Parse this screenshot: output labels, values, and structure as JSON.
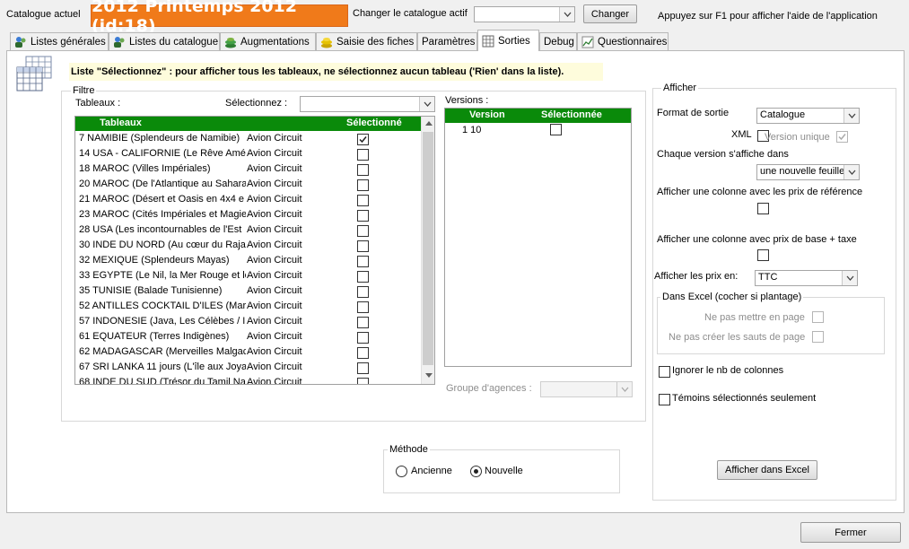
{
  "header": {
    "current_catalog_label": "Catalogue actuel",
    "catalog_name": "2012 Printemps 2012 (id:18)",
    "change_label": "Changer le catalogue actif",
    "change_button": "Changer",
    "help_text": "Appuyez sur F1 pour afficher l'aide de l'application"
  },
  "tabs": [
    {
      "label": "Listes générales",
      "icon": "people-icon"
    },
    {
      "label": "Listes du catalogue",
      "icon": "people-icon"
    },
    {
      "label": "Augmentations",
      "icon": "coins-icon"
    },
    {
      "label": "Saisie des fiches",
      "icon": "coins-icon"
    },
    {
      "label": "Paramètres",
      "icon": ""
    },
    {
      "label": "Sorties",
      "icon": "table-icon"
    },
    {
      "label": "Debug",
      "icon": ""
    },
    {
      "label": "Questionnaires",
      "icon": "chart-icon"
    }
  ],
  "info_text": "Liste \"Sélectionnez\" : pour afficher tous les tableaux, ne sélectionnez aucun tableau ('Rien' dans la liste).",
  "filtre": {
    "legend": "Filtre",
    "tableaux_label": "Tableaux :",
    "select_label": "Sélectionnez :",
    "select_value": "",
    "columns": [
      "Tableaux",
      "Sélectionné"
    ],
    "rows": [
      {
        "name": "7 NAMIBIE (Splendeurs de Namibie)",
        "type": "Avion Circuit",
        "checked": true
      },
      {
        "name": "14 USA - CALIFORNIE (Le Rêve Amé",
        "type": "Avion Circuit",
        "checked": false
      },
      {
        "name": "18 MAROC (Villes Impériales)",
        "type": "Avion Circuit",
        "checked": false
      },
      {
        "name": "20 MAROC (De l'Atlantique au Sahara",
        "type": "Avion Circuit",
        "checked": false
      },
      {
        "name": "21 MAROC (Désert et Oasis en 4x4 e",
        "type": "Avion Circuit",
        "checked": false
      },
      {
        "name": "23 MAROC (Cités Impériales et Magie",
        "type": "Avion Circuit",
        "checked": false
      },
      {
        "name": "28 USA (Les incontournables de l'Est",
        "type": "Avion Circuit",
        "checked": false
      },
      {
        "name": "30 INDE DU NORD (Au cœur du Raja",
        "type": "Avion Circuit",
        "checked": false
      },
      {
        "name": "32 MEXIQUE (Splendeurs Mayas)",
        "type": "Avion Circuit",
        "checked": false
      },
      {
        "name": "33 EGYPTE (Le Nil, la Mer Rouge et le",
        "type": "Avion Circuit",
        "checked": false
      },
      {
        "name": "35 TUNISIE (Balade Tunisienne)",
        "type": "Avion Circuit",
        "checked": false
      },
      {
        "name": "52 ANTILLES COCKTAIL D'ILES (Marie",
        "type": "Avion Circuit",
        "checked": false
      },
      {
        "name": "57 INDONESIE (Java, Les Célèbes / I",
        "type": "Avion Circuit",
        "checked": false
      },
      {
        "name": "61 EQUATEUR (Terres Indigènes)",
        "type": "Avion Circuit",
        "checked": false
      },
      {
        "name": "62 MADAGASCAR (Merveilles Malgac",
        "type": "Avion Circuit",
        "checked": false
      },
      {
        "name": "67 SRI LANKA 11 jours (L'île aux Joya",
        "type": "Avion Circuit",
        "checked": false
      },
      {
        "name": "68 INDE DU SUD (Trésor du Tamil Na",
        "type": "Avion Circuit",
        "checked": false
      }
    ],
    "versions_label": "Versions :",
    "version_columns": [
      "Version",
      "Sélectionnée"
    ],
    "versions": [
      {
        "version": "1 10",
        "checked": false
      }
    ],
    "groupe_label": "Groupe d'agences :",
    "groupe_value": ""
  },
  "methode": {
    "legend": "Méthode",
    "options": [
      {
        "label": "Ancienne",
        "selected": false
      },
      {
        "label": "Nouvelle",
        "selected": true
      }
    ]
  },
  "afficher": {
    "legend": "Afficher",
    "format_label": "Format de sortie",
    "format_value": "Catalogue",
    "xml_label": "XML",
    "version_unique_label": "Version unique",
    "version_unique_checked": true,
    "chaque_version_label": "Chaque version s'affiche dans",
    "chaque_version_value": "une nouvelle feuille",
    "prix_reference_label": "Afficher une colonne avec les prix de référence",
    "prix_base_label": "Afficher une colonne avec prix de base + taxe",
    "prix_en_label": "Afficher les prix en:",
    "prix_en_value": "TTC",
    "dans_excel_legend": "Dans Excel (cocher si plantage)",
    "ne_pas_page_label": "Ne pas mettre en page",
    "ne_pas_sauts_label": "Ne pas créer les sauts de page",
    "ignorer_label": "Ignorer le nb de colonnes",
    "temoins_label": "Témoins sélectionnés seulement",
    "excel_button": "Afficher dans Excel"
  },
  "footer": {
    "close_button": "Fermer"
  },
  "colors": {
    "accent_orange": "#f07a1a",
    "green_header": "#0a8a0a",
    "info_bg": "#fefcdc"
  }
}
